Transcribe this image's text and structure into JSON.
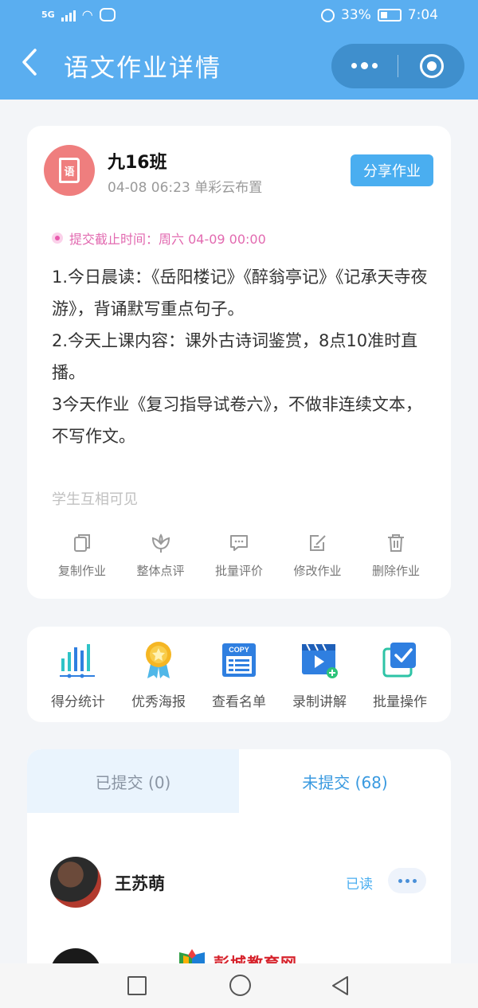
{
  "status_bar": {
    "network": "5G",
    "battery": "33%",
    "time": "7:04"
  },
  "header": {
    "title": "语文作业详情"
  },
  "assignment": {
    "book_char": "语",
    "class_name": "九16班",
    "subtitle": "04-08 06:23 单彩云布置",
    "share_label": "分享作业",
    "deadline": "提交截止时间：周六 04-09 00:00",
    "lines": [
      "1.今日晨读：《岳阳楼记》《醉翁亭记》《记承天寺夜游》，背诵默写重点句子。",
      "2.今天上课内容：课外古诗词鉴赏，8点10准时直播。",
      "3今天作业《复习指导试卷六》，不做非连续文本，不写作文。"
    ],
    "visibility": "学生互相可见",
    "actions": [
      "复制作业",
      "整体点评",
      "批量评价",
      "修改作业",
      "删除作业"
    ]
  },
  "tools": [
    "得分统计",
    "优秀海报",
    "查看名单",
    "录制讲解",
    "批量操作"
  ],
  "tools_copy_label": "COPY",
  "tabs": {
    "submitted": "已提交 (0)",
    "not_submitted": "未提交 (68)"
  },
  "students": [
    {
      "name": "王苏萌",
      "status": "已读"
    }
  ],
  "watermark": "彭城教育网",
  "colors": {
    "header": "#5aaef0",
    "accent": "#4aaef0",
    "deadline": "#e26ab0",
    "avatar": "#ef7e7e"
  }
}
